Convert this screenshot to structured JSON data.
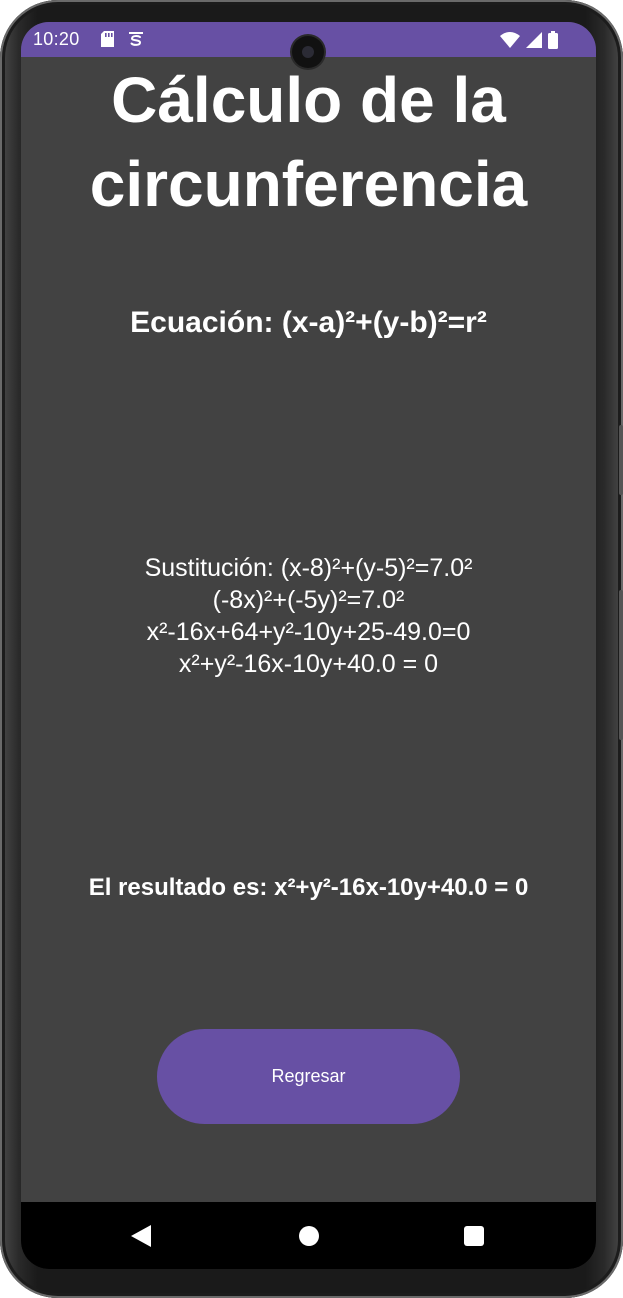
{
  "status_bar": {
    "time": "10:20",
    "left_icons": [
      "sd-card-icon",
      "notification-s-icon"
    ],
    "right_icons": [
      "wifi-icon",
      "cell-signal-icon",
      "battery-icon"
    ],
    "background_color": "#6750a4"
  },
  "main": {
    "title": "Cálculo de la circunferencia",
    "equation": "Ecuación: (x-a)²+(y-b)²=r²",
    "steps": [
      "Sustitución: (x-8)²+(y-5)²=7.0²",
      "(-8x)²+(-5y)²=7.0²",
      "x²-16x+64+y²-10y+25-49.0=0",
      "x²+y²-16x-10y+40.0 = 0"
    ],
    "result": "El resultado es: x²+y²-16x-10y+40.0 = 0",
    "back_button_label": "Regresar",
    "background_color": "#424242",
    "accent_color": "#6750a4"
  },
  "nav_bar": {
    "icons": [
      "back-triangle-icon",
      "home-circle-icon",
      "recents-square-icon"
    ]
  }
}
